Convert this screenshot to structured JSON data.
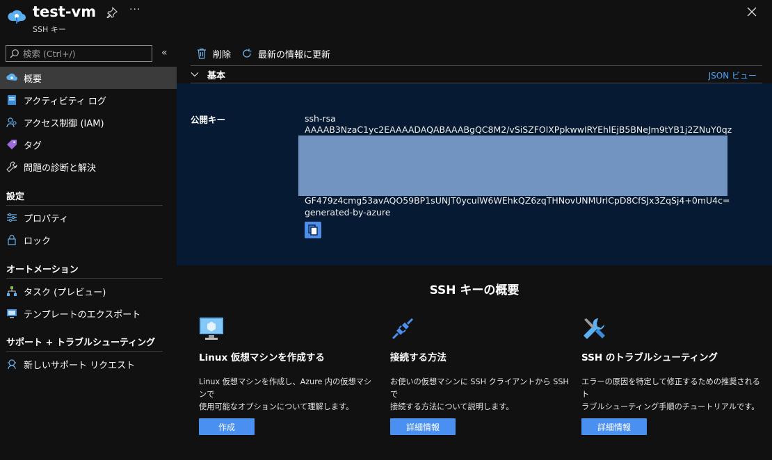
{
  "header": {
    "title": "test-vm",
    "subtitle": "SSH キー",
    "more": "···"
  },
  "search": {
    "placeholder": "検索 (Ctrl+/)"
  },
  "sidebar": {
    "collapse": "«",
    "items": [
      {
        "label": "概要"
      },
      {
        "label": "アクティビティ ログ"
      },
      {
        "label": "アクセス制御 (IAM)"
      },
      {
        "label": "タグ"
      },
      {
        "label": "問題の診断と解決"
      }
    ],
    "groups": [
      {
        "label": "設定",
        "items": [
          {
            "label": "プロパティ"
          },
          {
            "label": "ロック"
          }
        ]
      },
      {
        "label": "オートメーション",
        "items": [
          {
            "label": "タスク (プレビュー)"
          },
          {
            "label": "テンプレートのエクスポート"
          }
        ]
      },
      {
        "label": "サポート + トラブルシューティング",
        "items": [
          {
            "label": "新しいサポート リクエスト"
          }
        ]
      }
    ]
  },
  "toolbar": {
    "delete_label": "削除",
    "refresh_label": "最新の情報に更新"
  },
  "section": {
    "label": "基本",
    "json_view": "JSON ビュー"
  },
  "key": {
    "label": "公開キー",
    "line1": "ssh-rsa",
    "line2": "AAAAB3NzaC1yc2EAAAADAQABAAABgQC8M2/vSiSZFOlXPpkwwIRYEhlEjB5BNeJm9tYB1j2ZNuY0qz",
    "line3": "GF479z4cmg53avAQO59BP1sUNJT0yculW6WEhkQZ6zqTHNovUNMUrlCpD8CfSJx3ZqSj4+0mU4c=",
    "line4": "generated-by-azure"
  },
  "overview": {
    "title": "SSH キーの概要",
    "cards": [
      {
        "title": "Linux 仮想マシンを作成する",
        "desc1": "Linux 仮想マシンを作成し、Azure 内の仮想マシンで",
        "desc2": "使用可能なオプションについて理解します。",
        "button": "作成"
      },
      {
        "title": "接続する方法",
        "desc1": "お使いの仮想マシンに SSH クライアントから SSH で",
        "desc2": "接続する方法について説明します。",
        "button": "詳細情報"
      },
      {
        "title": "SSH のトラブルシューティング",
        "desc1": "エラーの原因を特定して修正するための推奨されるト",
        "desc2": "ラブルシューティング手順のチュートリアルです。",
        "button": "詳細情報"
      }
    ]
  },
  "colors": {
    "accent": "#4a90f0",
    "link": "#4aa3ff",
    "key_panel": "#061a33",
    "active_item": "#3b3b3b"
  }
}
